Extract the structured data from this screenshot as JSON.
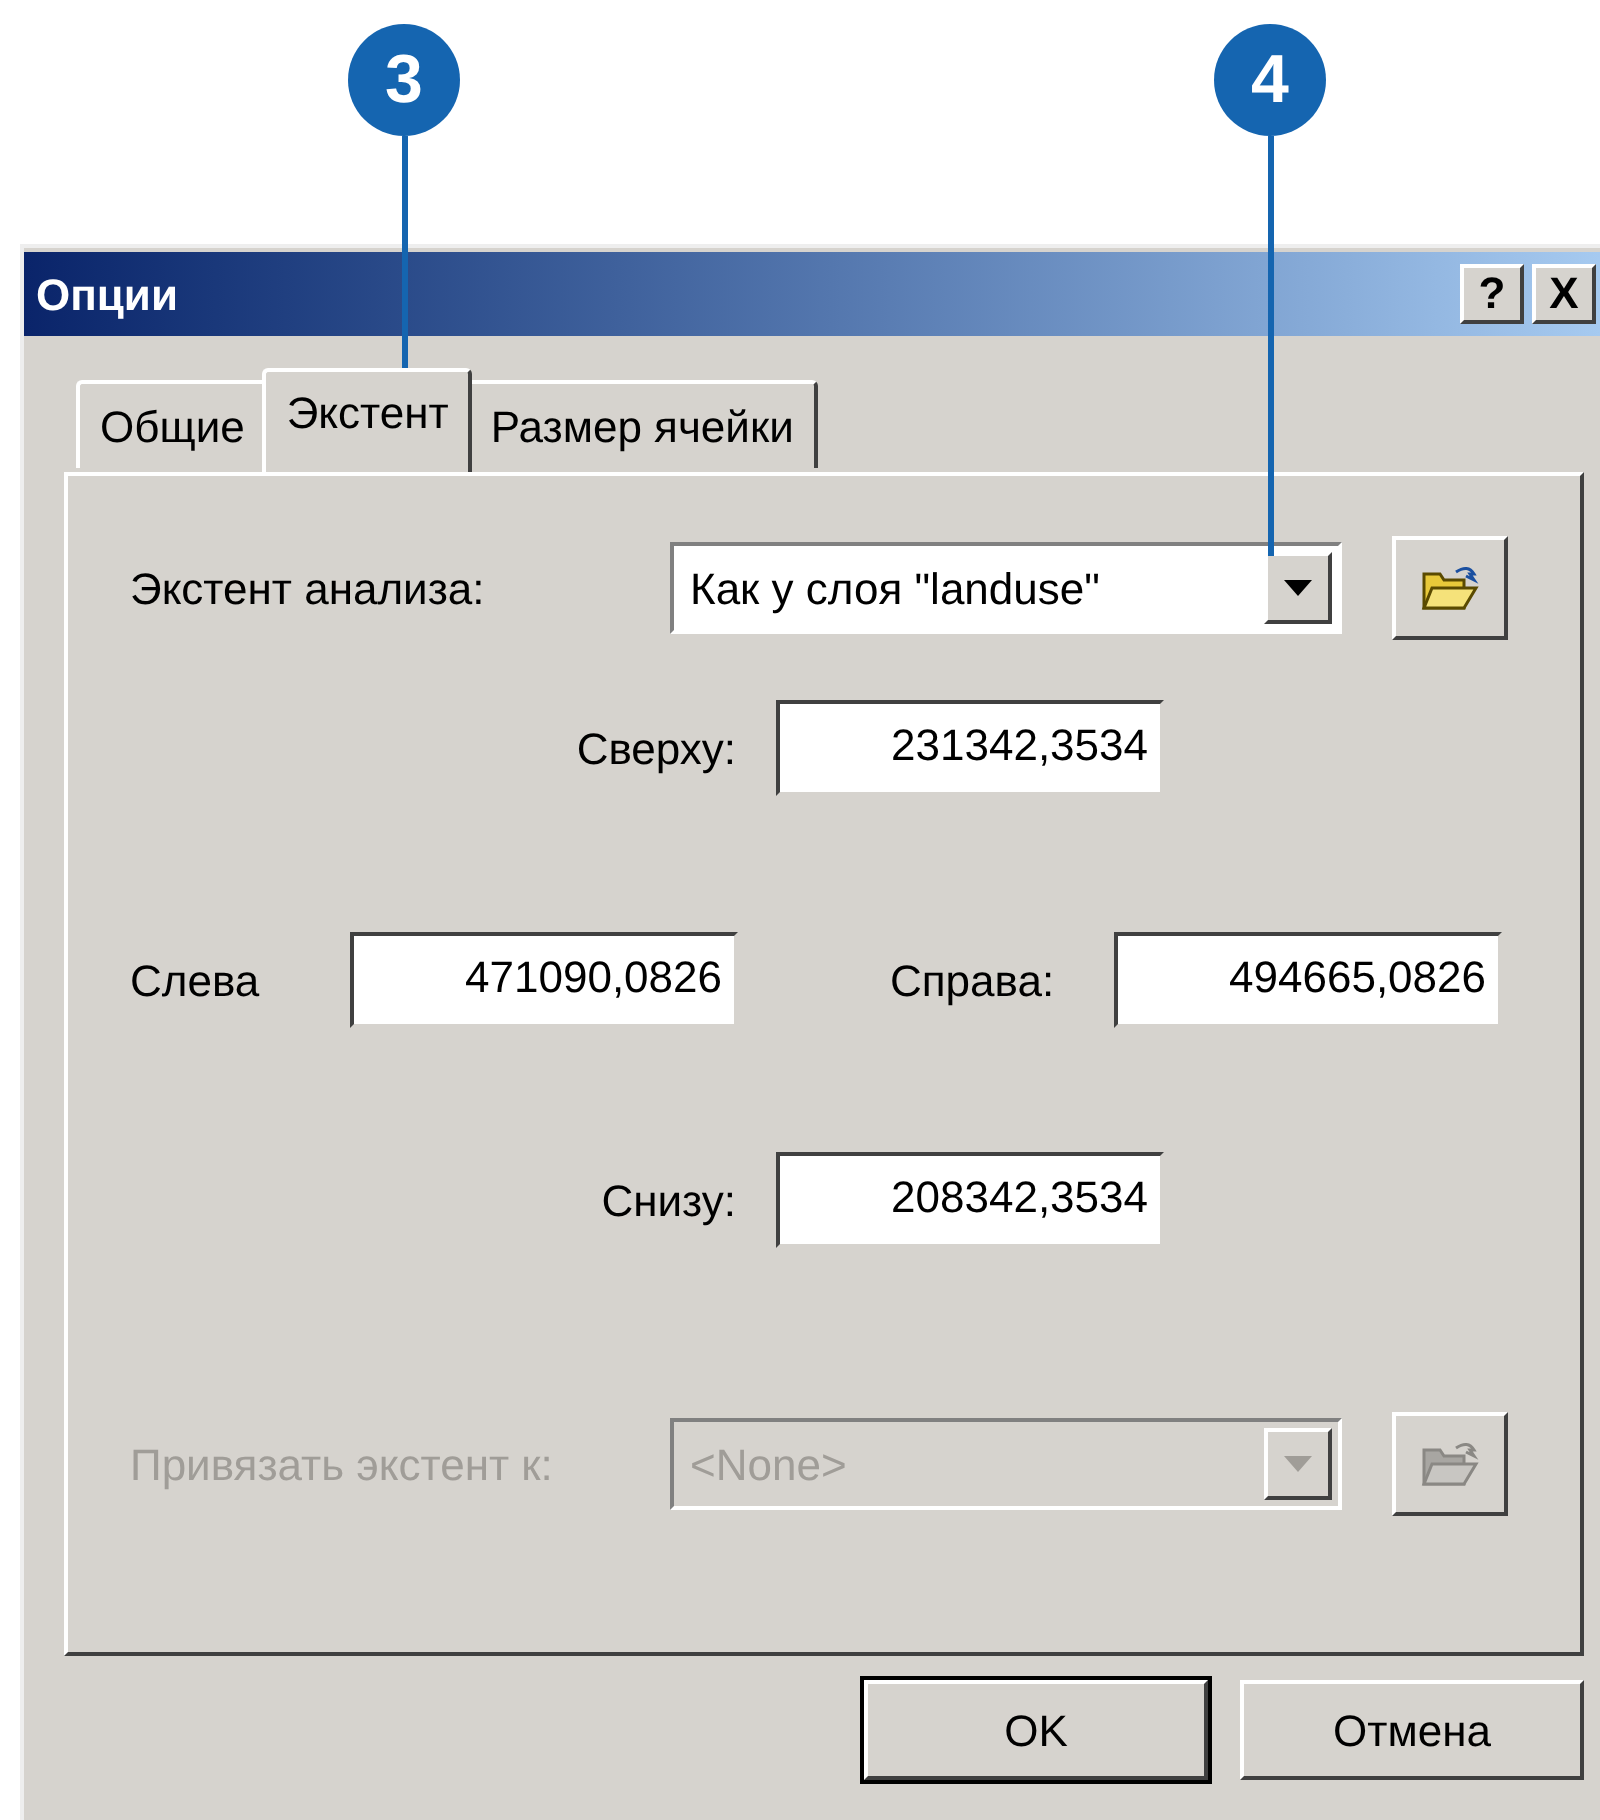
{
  "callouts": [
    {
      "number": "3"
    },
    {
      "number": "4"
    }
  ],
  "window": {
    "title": "Опции",
    "title_buttons": [
      "?",
      "X"
    ]
  },
  "tabs": [
    {
      "label": "Общие",
      "selected": false
    },
    {
      "label": "Экстент",
      "selected": true
    },
    {
      "label": "Размер ячейки",
      "selected": false
    }
  ],
  "extent": {
    "label": "Экстент анализа:",
    "value": "Как у слоя \"landuse\"",
    "disabled": false
  },
  "fields": [
    {
      "label": "Сверху:",
      "value": "231342,3534"
    },
    {
      "label": "Слева",
      "value": "471090,0826"
    },
    {
      "label": "Справа:",
      "value": "494665,0826"
    },
    {
      "label": "Снизу:",
      "value": "208342,3534"
    }
  ],
  "snap": {
    "label": "Привязать экстент к:",
    "value": "<None>",
    "disabled": true
  },
  "buttons": [
    {
      "label": "OK",
      "default": true
    },
    {
      "label": "Отмена",
      "default": false
    }
  ]
}
